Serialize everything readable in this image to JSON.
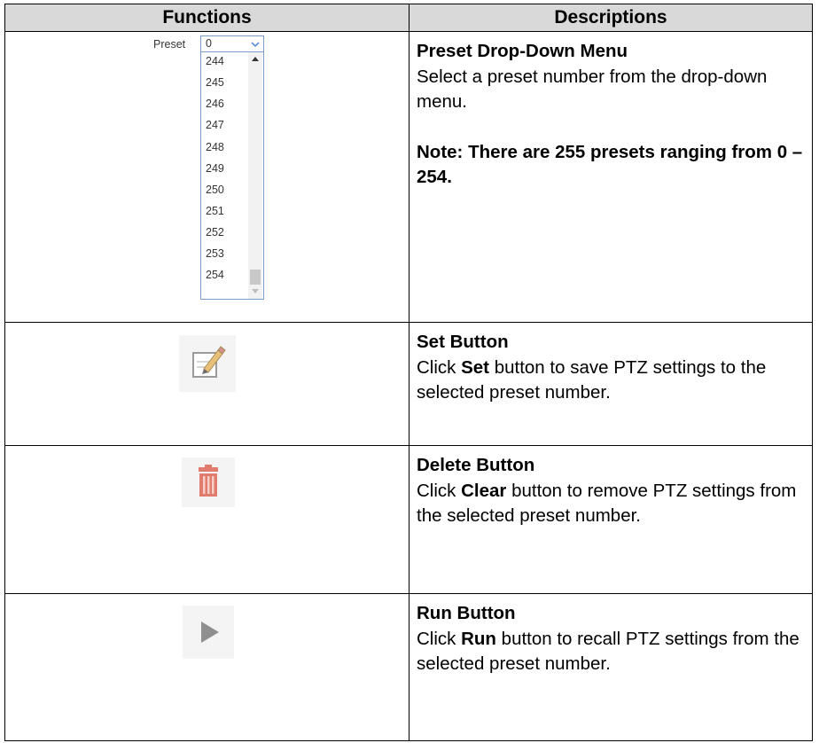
{
  "table": {
    "headers": {
      "functions": "Functions",
      "descriptions": "Descriptions"
    },
    "rows": [
      {
        "title": "Preset Drop-Down Menu",
        "text": "Select a preset number from the drop-down menu.",
        "note": "Note: There are 255 presets ranging from 0 – 254."
      },
      {
        "title": "Set Button",
        "pre": "Click ",
        "bold": "Set",
        "post": " button to save PTZ settings to the selected preset number."
      },
      {
        "title": "Delete Button",
        "pre": "Click ",
        "bold": "Clear",
        "post": " button to remove PTZ settings from the selected preset number."
      },
      {
        "title": "Run Button",
        "pre": "Click ",
        "bold": "Run",
        "post": " button to recall PTZ settings from the selected preset number."
      }
    ]
  },
  "preset_widget": {
    "label": "Preset",
    "selected": "0",
    "options": [
      "244",
      "245",
      "246",
      "247",
      "248",
      "249",
      "250",
      "251",
      "252",
      "253",
      "254"
    ]
  },
  "icons": {
    "set": "pencil-edit-icon",
    "delete": "trash-can-icon",
    "run": "play-icon",
    "delete_color": "#e07b6e",
    "run_color": "#8f8f8f"
  }
}
